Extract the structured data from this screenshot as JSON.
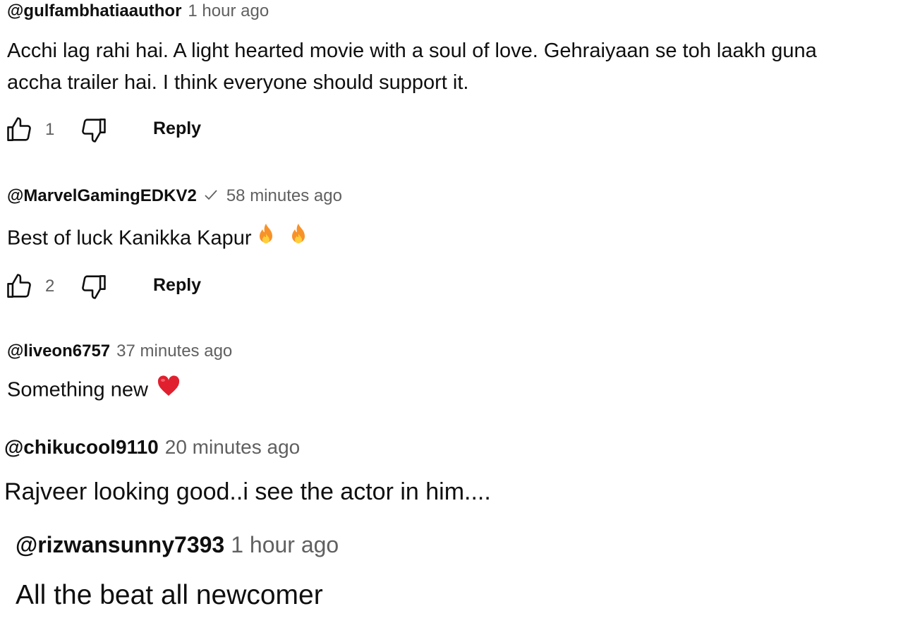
{
  "comments": [
    {
      "author": "@gulfambhatiaauthor",
      "time": "1 hour ago",
      "text_line1": "Acchi lag rahi hai. A light hearted movie with a soul of love. Gehraiyaan se toh laakh guna",
      "text_line2": "accha trailer hai. I think everyone should support it.",
      "likes": "1",
      "reply_label": "Reply"
    },
    {
      "author": "@MarvelGamingEDKV2",
      "verified_icon": "checkmark-icon",
      "time": "58 minutes ago",
      "text": "Best of luck Kanikka Kapur",
      "emojis": [
        "fire-icon",
        "fire-icon"
      ],
      "likes": "2",
      "reply_label": "Reply"
    },
    {
      "author": "@liveon6757",
      "time": "37 minutes ago",
      "text": "Something new",
      "emojis": [
        "red-heart-icon"
      ]
    },
    {
      "author": "@chikucool9110",
      "time": "20 minutes ago",
      "text": "Rajveer looking good..i see the actor in him...."
    },
    {
      "author": "@rizwansunny7393",
      "time": "1 hour ago",
      "text": "All the beat all newcomer"
    }
  ],
  "colors": {
    "primary_text": "#0f0f0f",
    "secondary_text": "#606060",
    "fire_outer": "#f7922a",
    "fire_inner": "#ffce3a",
    "heart": "#e0202e"
  }
}
